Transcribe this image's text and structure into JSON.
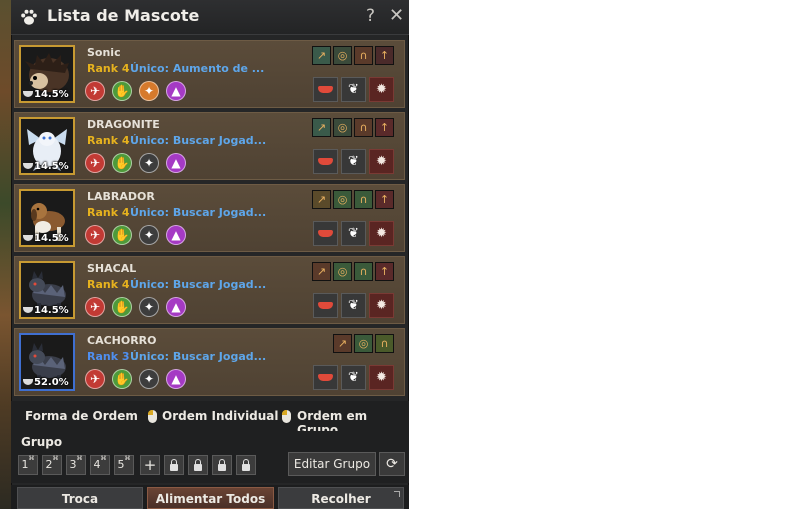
{
  "window": {
    "title": "Lista de Mascote",
    "help_label": "?",
    "close_label": "✕"
  },
  "pets": [
    {
      "name": "Sonic",
      "rank": "Rank 4",
      "skill": "Único: Aumento de ...",
      "hunger": "14.5%",
      "portrait": "hedgehog",
      "frame_color": "#c79a32",
      "rank_color": "#e6b21e",
      "circles": [
        "red",
        "green",
        "orange",
        "purple"
      ],
      "skill_icons": [
        "#3a5a4a",
        "#3a4a3a",
        "#5a3a2a",
        "#4a2a2a"
      ]
    },
    {
      "name": "DRAGONITE",
      "rank": "Rank 4",
      "skill": "Único: Buscar Jogad...",
      "hunger": "14.5%",
      "portrait": "dragon",
      "frame_color": "#c79a32",
      "rank_color": "#e6b21e",
      "circles": [
        "red",
        "green",
        "grey",
        "purple"
      ],
      "skill_icons": [
        "#3a5a4a",
        "#3a4a3a",
        "#5a3a2a",
        "#5a2a2a"
      ]
    },
    {
      "name": "LABRADOR",
      "rank": "Rank 4",
      "skill": "Único: Buscar Jogad...",
      "hunger": "14.5%",
      "portrait": "dog",
      "frame_color": "#c79a32",
      "rank_color": "#e6b21e",
      "circles": [
        "red",
        "green",
        "grey",
        "purple"
      ],
      "skill_icons": [
        "#5a4a2a",
        "#3a5a3a",
        "#3a5a3a",
        "#5a2a2a"
      ]
    },
    {
      "name": "SHACAL",
      "rank": "Rank 4",
      "skill": "Único: Buscar Jogad...",
      "hunger": "14.5%",
      "portrait": "wolf",
      "frame_color": "#c79a32",
      "rank_color": "#e6b21e",
      "circles": [
        "red",
        "green",
        "grey",
        "purple"
      ],
      "skill_icons": [
        "#5a3a2a",
        "#3a5a3a",
        "#3a5a3a",
        "#5a2a2a"
      ]
    },
    {
      "name": "CACHORRO",
      "rank": "Rank 3",
      "skill": "Único: Buscar Jogad...",
      "hunger": "52.0%",
      "portrait": "wolf",
      "frame_color": "#3f6fd1",
      "rank_color": "#4f8ff0",
      "circles": [
        "red",
        "green",
        "grey",
        "purple"
      ],
      "skill_icons": [
        "#5a3a2a",
        "#3a5a3a",
        "#4a5a2a"
      ]
    }
  ],
  "order_bar": {
    "label": "Forma de Ordem",
    "individual": "Ordem Individual",
    "group": "Ordem em Grupo"
  },
  "group": {
    "label": "Grupo",
    "slots": [
      "1",
      "2",
      "3",
      "4",
      "5"
    ],
    "add_label": "+",
    "edit_label": "Editar Grupo",
    "refresh_label": "⟳"
  },
  "bottom": {
    "trade": "Troca",
    "feed_all": "Alimentar Todos",
    "collect": "Recolher"
  },
  "colors": {
    "row_bg": "#5b4c3a",
    "rank_gold": "#e6b21e",
    "rank_blue": "#4f8ff0",
    "skill_blue": "#5ea6ea"
  }
}
